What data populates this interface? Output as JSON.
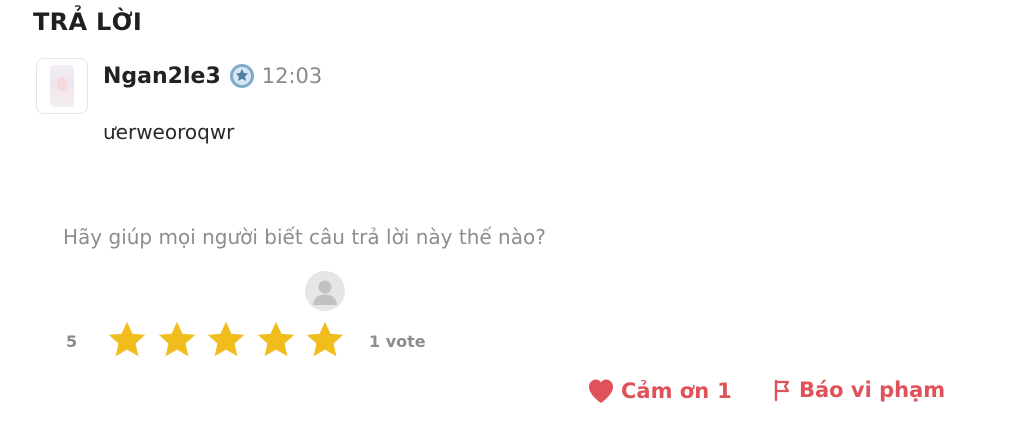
{
  "section": {
    "title": "TRẢ LỜI"
  },
  "answer": {
    "username": "Ngan2le3",
    "time": "12:03",
    "text": "ưerweoroqwr",
    "badge_icon": "medal-badge-icon"
  },
  "rating": {
    "prompt": "Hãy giúp mọi người biết câu trả lời này thế nào?",
    "value": "5",
    "stars_filled": 5,
    "stars_total": 5,
    "vote_count": "1 vote",
    "star_color": "#f0bd1c"
  },
  "actions": {
    "thanks_label": "Cảm ơn",
    "thanks_count": "1",
    "report_label": "Báo vi phạm",
    "accent_color": "#e0525a"
  }
}
